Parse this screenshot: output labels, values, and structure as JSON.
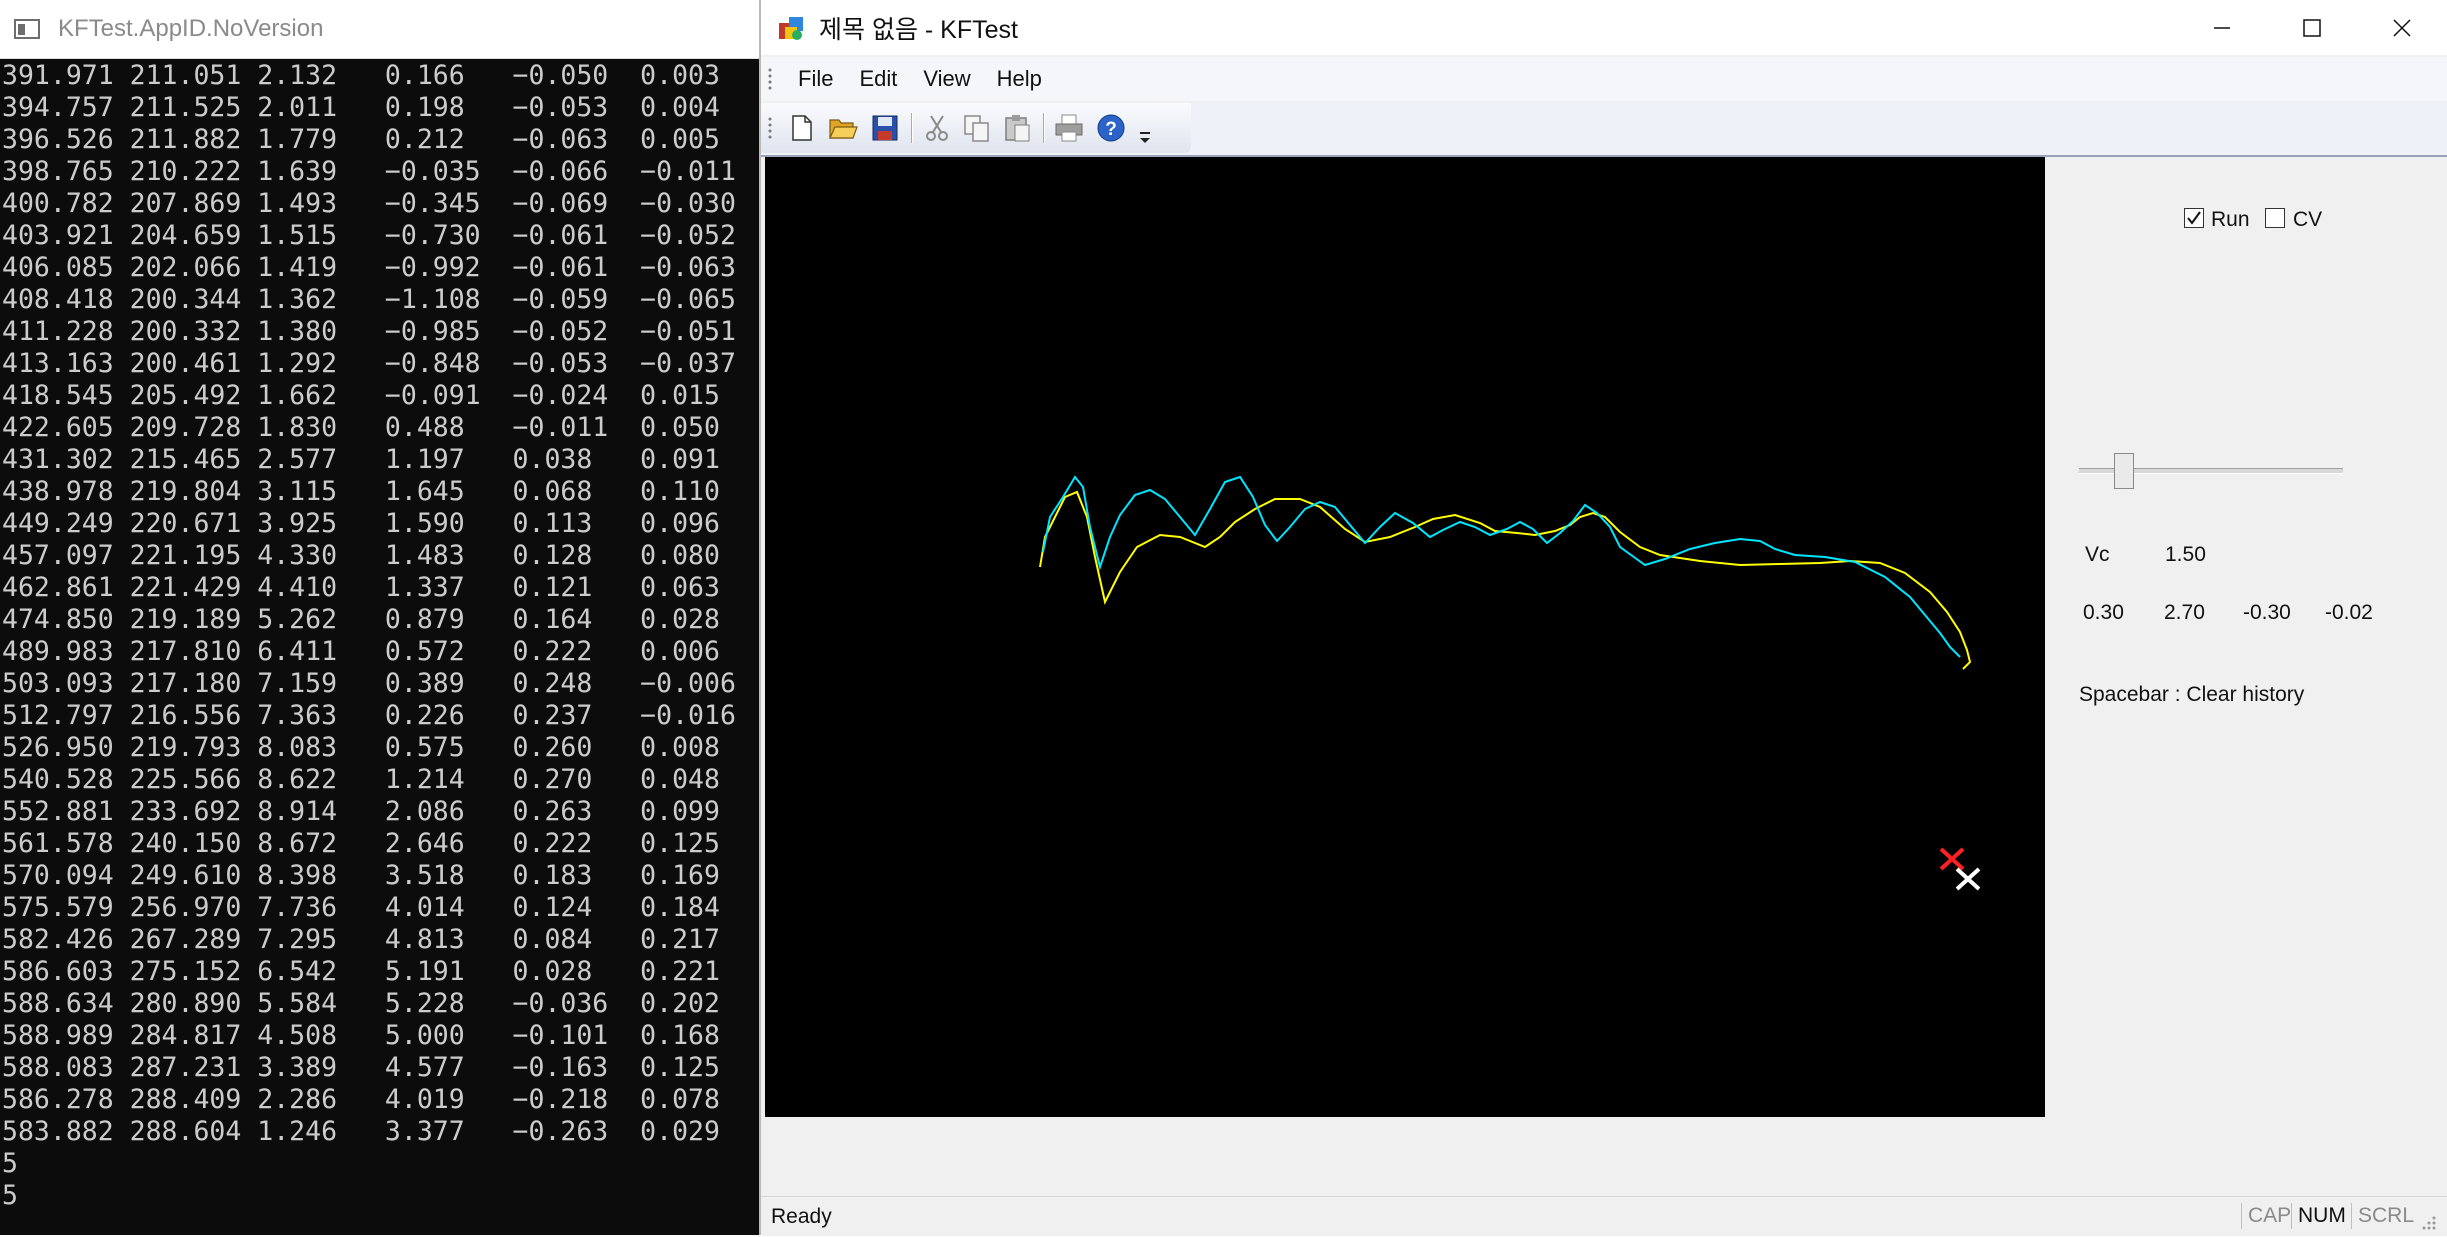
{
  "console": {
    "title": "KFTest.AppID.NoVersion",
    "lines": [
      "391.971 211.051 2.132   0.166   −0.050  0.003",
      "394.757 211.525 2.011   0.198   −0.053  0.004",
      "396.526 211.882 1.779   0.212   −0.063  0.005",
      "398.765 210.222 1.639   −0.035  −0.066  −0.011",
      "400.782 207.869 1.493   −0.345  −0.069  −0.030",
      "403.921 204.659 1.515   −0.730  −0.061  −0.052",
      "406.085 202.066 1.419   −0.992  −0.061  −0.063",
      "408.418 200.344 1.362   −1.108  −0.059  −0.065",
      "411.228 200.332 1.380   −0.985  −0.052  −0.051",
      "413.163 200.461 1.292   −0.848  −0.053  −0.037",
      "418.545 205.492 1.662   −0.091  −0.024  0.015",
      "422.605 209.728 1.830   0.488   −0.011  0.050",
      "431.302 215.465 2.577   1.197   0.038   0.091",
      "438.978 219.804 3.115   1.645   0.068   0.110",
      "449.249 220.671 3.925   1.590   0.113   0.096",
      "457.097 221.195 4.330   1.483   0.128   0.080",
      "462.861 221.429 4.410   1.337   0.121   0.063",
      "474.850 219.189 5.262   0.879   0.164   0.028",
      "489.983 217.810 6.411   0.572   0.222   0.006",
      "503.093 217.180 7.159   0.389   0.248   −0.006",
      "512.797 216.556 7.363   0.226   0.237   −0.016",
      "526.950 219.793 8.083   0.575   0.260   0.008",
      "540.528 225.566 8.622   1.214   0.270   0.048",
      "552.881 233.692 8.914   2.086   0.263   0.099",
      "561.578 240.150 8.672   2.646   0.222   0.125",
      "570.094 249.610 8.398   3.518   0.183   0.169",
      "575.579 256.970 7.736   4.014   0.124   0.184",
      "582.426 267.289 7.295   4.813   0.084   0.217",
      "586.603 275.152 6.542   5.191   0.028   0.221",
      "588.634 280.890 5.584   5.228   −0.036  0.202",
      "588.989 284.817 4.508   5.000   −0.101  0.168",
      "588.083 287.231 3.389   4.577   −0.163  0.125",
      "586.278 288.409 2.286   4.019   −0.218  0.078",
      "583.882 288.604 1.246   3.377   −0.263  0.029",
      "5",
      "5"
    ]
  },
  "window": {
    "title": "제목 없음 - KFTest",
    "menu": [
      "File",
      "Edit",
      "View",
      "Help"
    ],
    "toolbar_icons": [
      "new-icon",
      "open-icon",
      "save-icon",
      "cut-icon",
      "copy-icon",
      "paste-icon",
      "print-icon",
      "help-icon",
      "overflow-icon"
    ]
  },
  "panel": {
    "run_label": "Run",
    "run_checked": true,
    "cv_label": "CV",
    "cv_checked": false,
    "vc_label": "Vc",
    "vc_value": "1.50",
    "slider_fraction": 0.17,
    "values": [
      "0.30",
      "2.70",
      "-0.30",
      "-0.02"
    ],
    "hint": "Spacebar : Clear history"
  },
  "status": {
    "text": "Ready",
    "indicators": [
      "CAP",
      "NUM",
      "SCRL"
    ]
  },
  "colors": {
    "measured_track": "#00e5ff",
    "filtered_track": "#ffff00",
    "measured_marker": "#ff2020",
    "estimate_marker": "#ffffff"
  }
}
